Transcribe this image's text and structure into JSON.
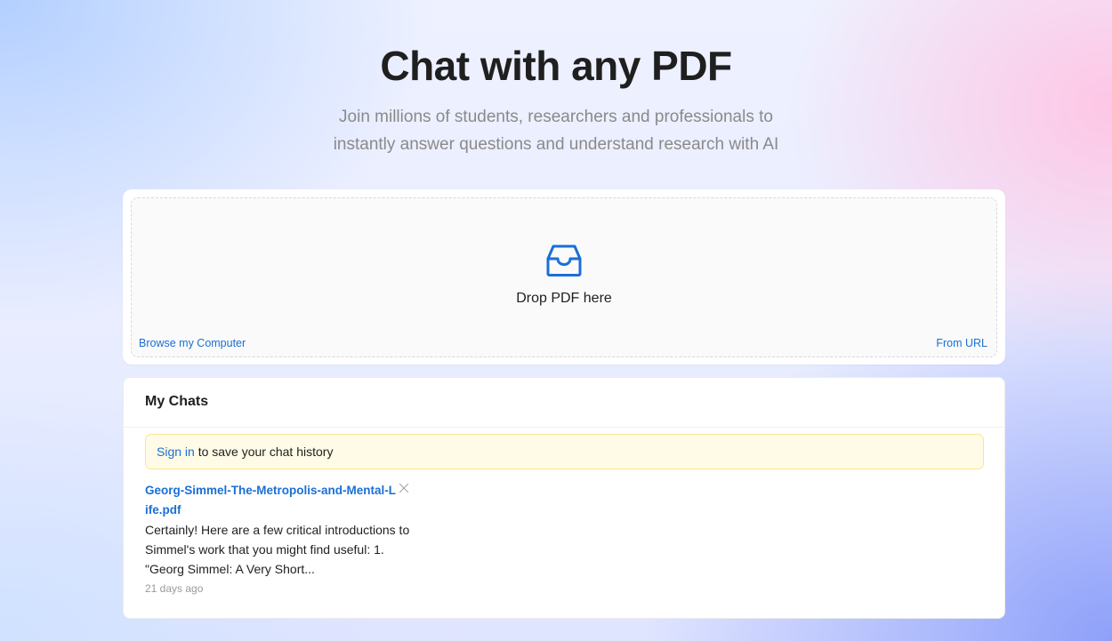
{
  "hero": {
    "title": "Chat with any PDF",
    "subtitle_line1": "Join millions of students, researchers and professionals to",
    "subtitle_line2": "instantly answer questions and understand research with AI"
  },
  "upload": {
    "icon": "inbox-icon",
    "drop_label": "Drop PDF here",
    "browse_label": "Browse my Computer",
    "url_label": "From URL",
    "accent_color": "#1a6fd6"
  },
  "chats": {
    "title": "My Chats",
    "alert": {
      "link_text": "Sign in",
      "text": " to save your chat history",
      "background": "#fffbe6",
      "border": "#ffe58f"
    },
    "items": [
      {
        "file_name": "Georg-Simmel-The-Metropolis-and-Mental-Life.pdf",
        "snippet": "Certainly! Here are a few critical introductions to Simmel's work that you might find useful: 1. \"Georg Simmel: A Very Short...",
        "time": "21 days ago",
        "close_icon": "close-icon"
      }
    ]
  }
}
